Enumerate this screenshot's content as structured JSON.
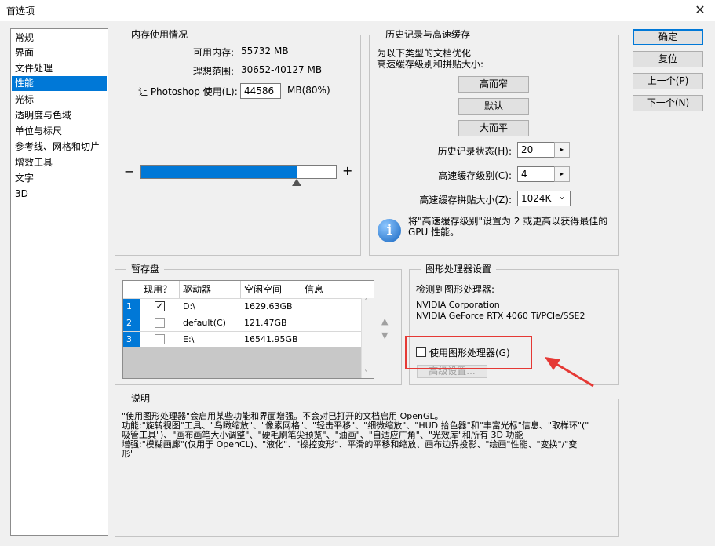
{
  "window": {
    "title": "首选项",
    "close_glyph": "✕"
  },
  "categories": [
    {
      "label": "常规",
      "selected": false
    },
    {
      "label": "界面",
      "selected": false
    },
    {
      "label": "文件处理",
      "selected": false
    },
    {
      "label": "性能",
      "selected": true
    },
    {
      "label": "光标",
      "selected": false
    },
    {
      "label": "透明度与色域",
      "selected": false
    },
    {
      "label": "单位与标尺",
      "selected": false
    },
    {
      "label": "参考线、网格和切片",
      "selected": false
    },
    {
      "label": "增效工具",
      "selected": false
    },
    {
      "label": "文字",
      "selected": false
    },
    {
      "label": "3D",
      "selected": false
    }
  ],
  "memory": {
    "group_title": "内存使用情况",
    "available_label": "可用内存:",
    "available_value": "55732 MB",
    "ideal_label": "理想范围:",
    "ideal_value": "30652-40127 MB",
    "let_use_label": "让 Photoshop 使用(L):",
    "let_use_value": "44586",
    "let_use_unit": "MB(80%)",
    "minus": "−",
    "plus": "+",
    "slider_fraction": 0.8
  },
  "history": {
    "group_title": "历史记录与高速缓存",
    "desc_line1": "为以下类型的文档优化",
    "desc_line2": "高速缓存级别和拼贴大小:",
    "btn_tall_narrow": "高而窄",
    "btn_default": "默认",
    "btn_big_flat": "大而平",
    "history_states_label": "历史记录状态(H):",
    "history_states_value": "20",
    "cache_levels_label": "高速缓存级别(C):",
    "cache_levels_value": "4",
    "cache_tile_label": "高速缓存拼贴大小(Z):",
    "cache_tile_value": "1024K",
    "info_line1": "将\"高速缓存级别\"设置为 2 或更高以获得最佳的",
    "info_line2": "GPU 性能。",
    "step_glyph": "▸",
    "dropdown_glyph": "⌄",
    "info_glyph": "i"
  },
  "buttons": {
    "ok": "确定",
    "reset": "复位",
    "prev": "上一个(P)",
    "next": "下一个(N)"
  },
  "scratch": {
    "group_title": "暂存盘",
    "columns": [
      "现用？",
      "驱动器",
      "空闲空间",
      "信息"
    ],
    "rows": [
      {
        "num": "1",
        "active": true,
        "drive": "D:\\",
        "free": "1629.63GB",
        "info": ""
      },
      {
        "num": "2",
        "active": false,
        "drive": "default(C)",
        "free": "121.47GB",
        "info": ""
      },
      {
        "num": "3",
        "active": false,
        "drive": "E:\\",
        "free": "16541.95GB",
        "info": ""
      }
    ],
    "check_glyph": "✓",
    "up_glyph": "▲",
    "down_glyph": "▼",
    "scroll_up": "˄",
    "scroll_down": "˅"
  },
  "gpu": {
    "group_title": "图形处理器设置",
    "detected_label": "检测到图形处理器:",
    "vendor": "NVIDIA Corporation",
    "model": "NVIDIA GeForce RTX 4060 Ti/PCIe/SSE2",
    "use_gpu_label": "使用图形处理器(G)",
    "use_gpu_checked": false,
    "advanced_label": "高级设置..."
  },
  "description": {
    "group_title": "说明",
    "lines": [
      "\"使用图形处理器\"会启用某些功能和界面增强。不会对已打开的文档启用 OpenGL。",
      "功能:\"旋转视图\"工具、\"鸟瞰缩放\"、\"像素网格\"、\"轻击平移\"、\"细微缩放\"、\"HUD 拾色器\"和\"丰富光标\"信息、\"取样环\"(\"",
      "吸管工具\")、\"画布画笔大小调整\"、\"硬毛刷笔尖预览\"、\"油画\"、\"自适应广角\"、\"光效库\"和所有 3D 功能",
      "增强:\"模糊画廊\"(仅用于 OpenCL)、\"液化\"、\"操控变形\"、平滑的平移和缩放、画布边界投影、\"绘画\"性能、\"变换\"/\"变",
      "形\""
    ]
  },
  "colors": {
    "accent": "#0078d7",
    "highlight_box": "#e53935"
  }
}
